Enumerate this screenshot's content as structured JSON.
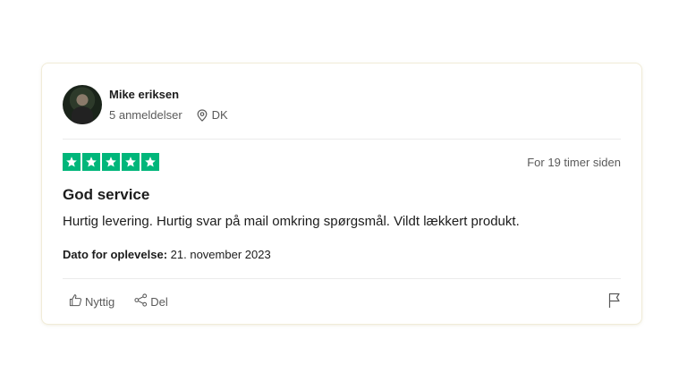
{
  "review": {
    "author_name": "Mike eriksen",
    "review_count": "5 anmeldelser",
    "country": "DK",
    "rating": 5,
    "rating_color": "#00b67a",
    "relative_date": "For 19 timer siden",
    "title": "God service",
    "text": "Hurtig levering. Hurtig svar på mail omkring spørgsmål. Vildt lækkert produkt.",
    "experience_label": "Dato for oplevelse:",
    "experience_date": "21. november 2023"
  },
  "actions": {
    "useful_label": "Nyttig",
    "share_label": "Del"
  },
  "icons": [
    "thumbs-up-icon",
    "share-icon",
    "flag-icon",
    "location-pin-icon",
    "star-icon"
  ]
}
